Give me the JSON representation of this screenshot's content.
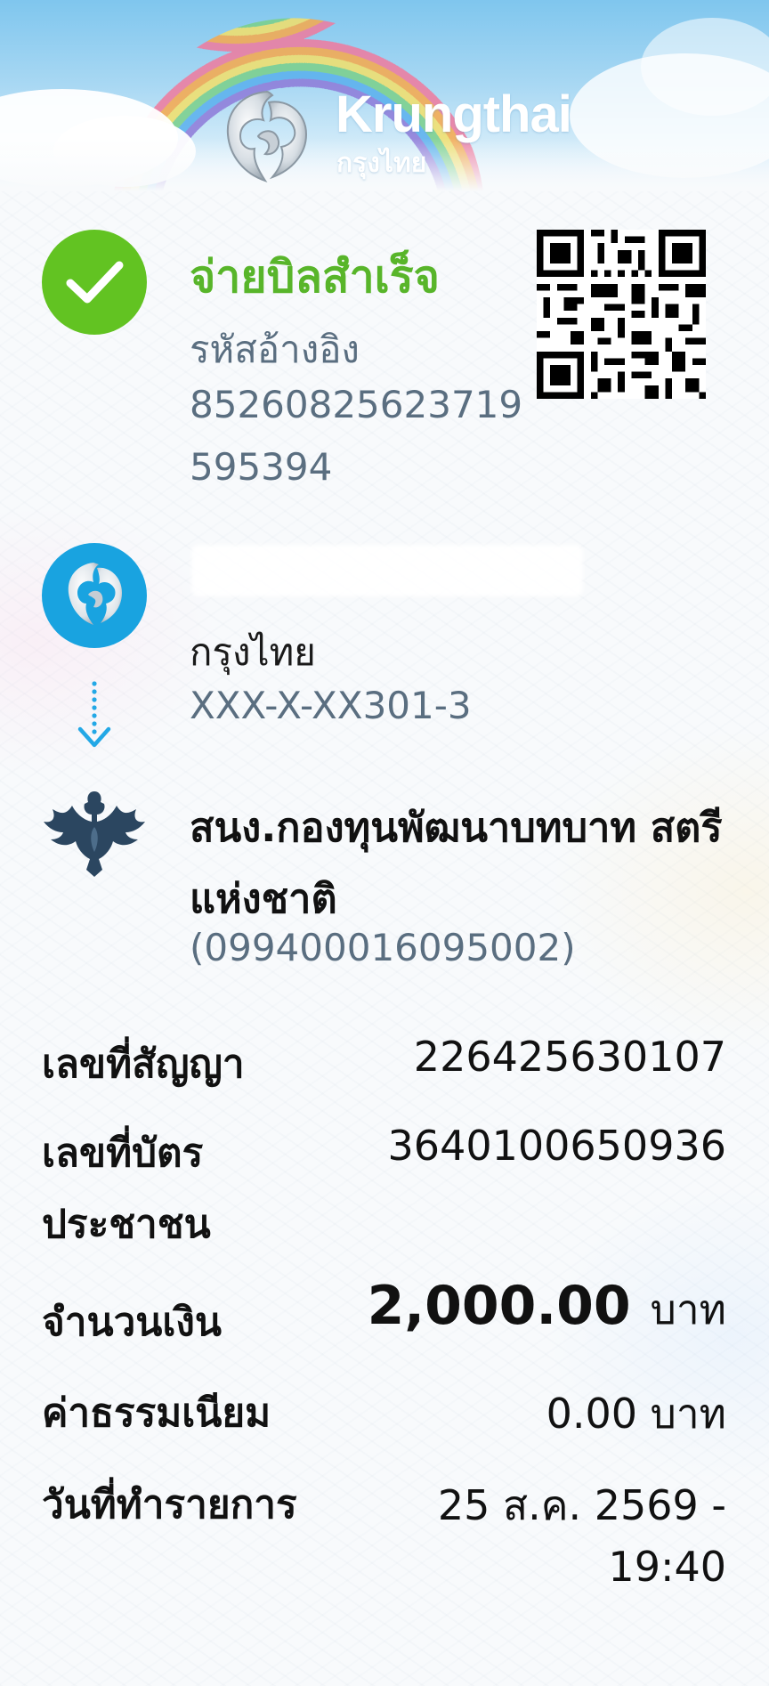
{
  "brand": {
    "name_en": "Krungthai",
    "name_th": "กรุงไทย"
  },
  "status": {
    "title": "จ่ายบิลสำเร็จ",
    "ref_label": "รหัสอ้างอิง",
    "ref_line1": "85260825623719",
    "ref_line2": "595394",
    "color": "#58b52a"
  },
  "sender": {
    "bank": "กรุงไทย",
    "account": "XXX-X-XX301-3"
  },
  "receiver": {
    "name": "สนง.กองทุนพัฒนาบทบาท สตรีแห่งชาติ",
    "id": "(099400016095002)"
  },
  "details": {
    "contract_label": "เลขที่สัญญา",
    "contract_value": "226425630107",
    "id_card_label_line1": "เลขที่บัตร",
    "id_card_label_line2": "ประชาชน",
    "id_card_value": "3640100650936",
    "amount_label": "จำนวนเงิน",
    "amount_value": "2,000.00",
    "amount_unit": "บาท",
    "fee_label": "ค่าธรรมเนียม",
    "fee_value": "0.00 บาท",
    "date_label": "วันที่ทำรายการ",
    "date_value_line1": "25 ส.ค. 2569 -",
    "date_value_line2": "19:40"
  },
  "colors": {
    "accent_blue": "#19a3e0",
    "text_gray": "#5a6e80",
    "garuda": "#2b4660"
  },
  "icons": {
    "success": "check-circle-icon",
    "sender": "krungthai-logo-icon",
    "arrow": "dotted-arrow-down-icon",
    "receiver": "garuda-emblem-icon",
    "qr": "qr-code-icon"
  }
}
